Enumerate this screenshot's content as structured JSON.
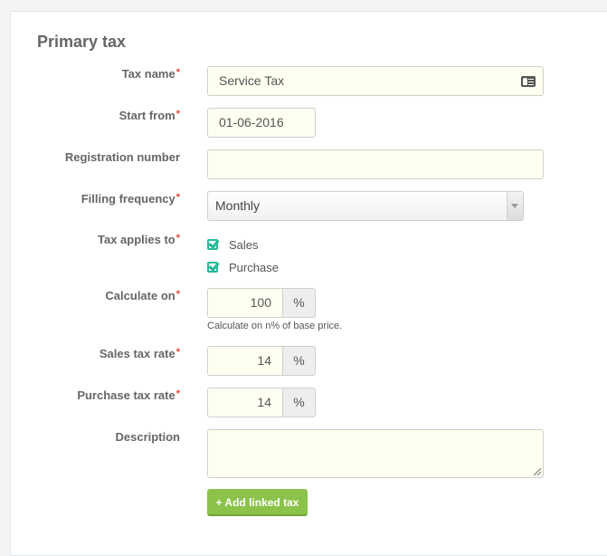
{
  "section": {
    "title": "Primary tax"
  },
  "required_marker": "*",
  "fields": {
    "tax_name": {
      "label": "Tax name",
      "required": true,
      "value": "Service Tax",
      "icon": "contact-card-icon"
    },
    "start_from": {
      "label": "Start from",
      "required": true,
      "value": "01-06-2016"
    },
    "registration_number": {
      "label": "Registration number",
      "required": false,
      "value": ""
    },
    "filling_frequency": {
      "label": "Filling frequency",
      "required": true,
      "selected": "Monthly",
      "icon": "dropdown-arrow-icon"
    },
    "tax_applies_to": {
      "label": "Tax applies to",
      "required": true,
      "options": [
        {
          "label": "Sales",
          "checked": true
        },
        {
          "label": "Purchase",
          "checked": true
        }
      ]
    },
    "calculate_on": {
      "label": "Calculate on",
      "required": true,
      "value": "100",
      "unit": "%",
      "help": "Calculate on n% of base price."
    },
    "sales_tax_rate": {
      "label": "Sales tax rate",
      "required": true,
      "value": "14",
      "unit": "%"
    },
    "purchase_tax_rate": {
      "label": "Purchase tax rate",
      "required": true,
      "value": "14",
      "unit": "%"
    },
    "description": {
      "label": "Description",
      "required": false,
      "value": ""
    }
  },
  "actions": {
    "add_linked_tax": "+ Add linked tax"
  },
  "colors": {
    "accent_green": "#8bc34a",
    "checkbox_teal": "#26b99a",
    "required_red": "#e8453c",
    "input_bg": "#fefff0"
  }
}
